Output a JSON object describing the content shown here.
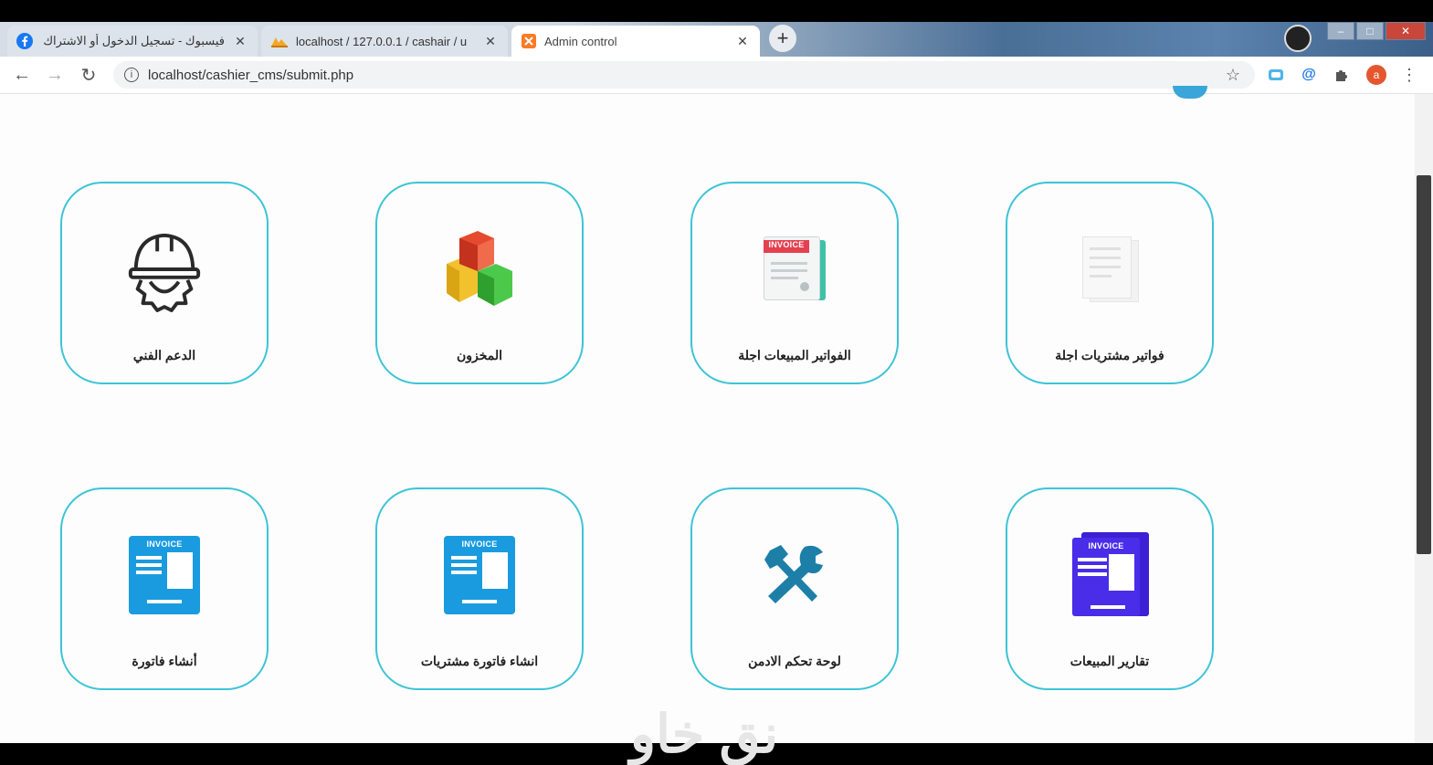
{
  "browser": {
    "tabs": [
      {
        "title": "فيسبوك - تسجيل الدخول أو الاشتراك",
        "icon": "facebook-icon",
        "active": false
      },
      {
        "title": "localhost / 127.0.0.1 / cashair / u",
        "icon": "phpmyadmin-icon",
        "active": false
      },
      {
        "title": "Admin control",
        "icon": "xampp-icon",
        "active": true
      }
    ],
    "new_tab": "+",
    "address": "localhost/cashier_cms/submit.php",
    "window_controls": {
      "minimize": "–",
      "maximize": "□",
      "close": "✕"
    },
    "profile_initial": "a"
  },
  "dashboard": {
    "cards": [
      {
        "label": "الدعم الفني",
        "icon": "support-helmet-gear-icon"
      },
      {
        "label": "المخزون",
        "icon": "inventory-boxes-icon"
      },
      {
        "label": "الفواتير المبيعات اجلة",
        "icon": "sales-invoice-icon",
        "badge": "INVOICE"
      },
      {
        "label": "فواتير مشتريات اجلة",
        "icon": "purchase-invoice-faded-icon"
      },
      {
        "label": "أنشاء فاتورة",
        "icon": "create-invoice-icon",
        "badge": "INVOICE"
      },
      {
        "label": "انشاء فاتورة مشتريات",
        "icon": "create-purchase-invoice-icon",
        "badge": "INVOICE"
      },
      {
        "label": "لوحة تحكم الادمن",
        "icon": "admin-tools-icon"
      },
      {
        "label": "تقارير المبيعات",
        "icon": "sales-report-invoice-icon",
        "badge": "INVOICE"
      }
    ]
  },
  "colors": {
    "card_border": "#3cc4d6",
    "invoice_blue": "#1a9be0",
    "report_purple": "#3d1fd6"
  }
}
